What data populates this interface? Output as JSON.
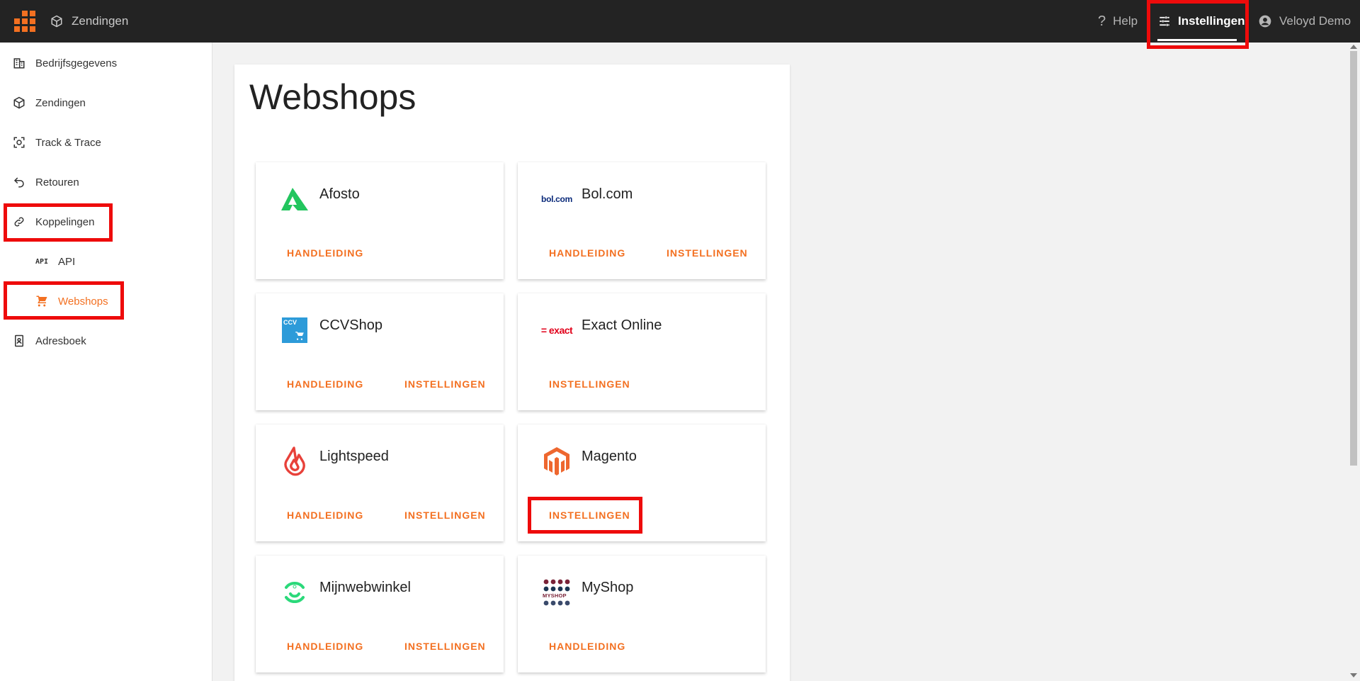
{
  "topbar": {
    "shipments_label": "Zendingen",
    "help_label": "Help",
    "settings_label": "Instellingen",
    "user_label": "Veloyd Demo",
    "accent_color": "#f37021",
    "background_color": "#232323"
  },
  "sidebar": {
    "items": [
      {
        "label": "Bedrijfsgegevens",
        "icon": "building-icon"
      },
      {
        "label": "Zendingen",
        "icon": "package-icon"
      },
      {
        "label": "Track & Trace",
        "icon": "track-icon"
      },
      {
        "label": "Retouren",
        "icon": "return-icon"
      },
      {
        "label": "Koppelingen",
        "icon": "link-icon"
      },
      {
        "label": "API",
        "icon": "api-icon"
      },
      {
        "label": "Webshops",
        "icon": "cart-icon",
        "active": true
      },
      {
        "label": "Adresboek",
        "icon": "addressbook-icon"
      }
    ]
  },
  "page": {
    "title": "Webshops"
  },
  "shops": [
    {
      "name": "Afosto",
      "actions": [
        "HANDLEIDING"
      ]
    },
    {
      "name": "Bol.com",
      "logo_text": "bol.com",
      "actions": [
        "HANDLEIDING",
        "INSTELLINGEN"
      ]
    },
    {
      "name": "CCVShop",
      "logo_text": "CCV",
      "actions": [
        "HANDLEIDING",
        "INSTELLINGEN"
      ]
    },
    {
      "name": "Exact Online",
      "logo_text": "= exact",
      "actions": [
        "INSTELLINGEN"
      ]
    },
    {
      "name": "Lightspeed",
      "actions": [
        "HANDLEIDING",
        "INSTELLINGEN"
      ]
    },
    {
      "name": "Magento",
      "actions": [
        "INSTELLINGEN"
      ]
    },
    {
      "name": "Mijnwebwinkel",
      "actions": [
        "HANDLEIDING",
        "INSTELLINGEN"
      ]
    },
    {
      "name": "MyShop",
      "logo_text": "MYSHOP",
      "actions": [
        "HANDLEIDING"
      ]
    }
  ]
}
